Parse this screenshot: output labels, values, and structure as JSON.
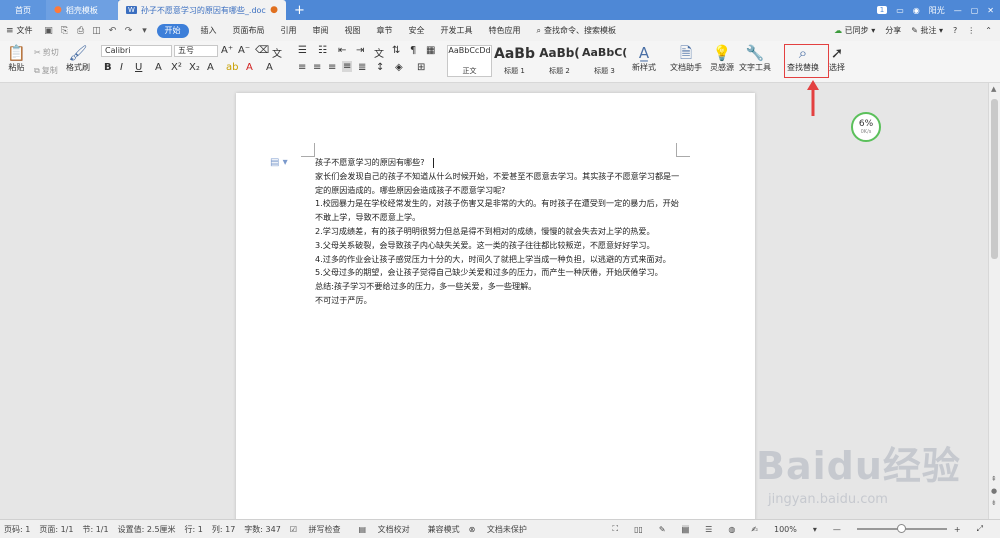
{
  "tabs": {
    "home": "首页",
    "template": "稻壳模板",
    "document": "孙子不愿意学习的原因有哪些_.doc",
    "page_badge": "1",
    "user": "阳光"
  },
  "menu": {
    "file": "文件",
    "items": [
      "开始",
      "插入",
      "页面布局",
      "引用",
      "审阅",
      "视图",
      "章节",
      "安全",
      "开发工具",
      "特色应用"
    ],
    "search": "查找命令、搜索模板",
    "sync": "已同步",
    "share": "分享",
    "comment": "批注"
  },
  "ribbon": {
    "paste": "粘贴",
    "cut": "剪切",
    "copy": "复制",
    "format_painter": "格式刷",
    "font_name": "Calibri",
    "font_size": "五号",
    "styles": [
      {
        "sample": "AaBbCcDd",
        "name": "正文"
      },
      {
        "sample": "AaBb",
        "name": "标题 1"
      },
      {
        "sample": "AaBb(",
        "name": "标题 2"
      },
      {
        "sample": "AaBbC(",
        "name": "标题 3"
      }
    ],
    "new_style": "新样式",
    "doc_helper": "文档助手",
    "inspiration": "灵感源",
    "text_tools": "文字工具",
    "find_replace": "查找替换",
    "select": "选择"
  },
  "document": {
    "lines": [
      "孩子不愿意学习的原因有哪些?",
      "家长们会发现自己的孩子不知道从什么时候开始，不爱甚至不愿意去学习。其实孩子不愿意学习都是一定的原因造成的。哪些原因会造成孩子不愿意学习呢?",
      "1.校园暴力是在学校经常发生的，对孩子伤害又是非常的大的。有时孩子在遭受到一定的暴力后，开始不敢上学，导致不愿意上学。",
      "2.学习成绩差，有的孩子明明很努力但总是得不到相对的成绩，慢慢的就会失去对上学的热爱。",
      "3.父母关系破裂，会导致孩子内心缺失关爱。这一类的孩子往往都比较叛逆，不愿意好好学习。",
      "4.过多的作业会让孩子感觉压力十分的大，时间久了就把上学当成一种负担，以逃避的方式来面对。",
      "5.父母过多的期望，会让孩子觉得自己缺少关爱和过多的压力，而产生一种厌倦，开始厌倦学习。",
      "总结:孩子学习不要给过多的压力，多一些关爱，多一些理解。",
      "不可过于严厉。"
    ]
  },
  "progress": {
    "percent": "6%",
    "speed": "0K/s"
  },
  "status": {
    "page_num": "页码: 1",
    "pages": "页面: 1/1",
    "section": "节: 1/1",
    "setting": "设置值: 2.5厘米",
    "row": "行: 1",
    "col": "列: 17",
    "words": "字数: 347",
    "spell": "拼写检查",
    "proof": "文档校对",
    "compat": "兼容模式",
    "protect": "文档未保护",
    "zoom": "100%",
    "zoom_fraction": 0.5
  },
  "watermark": {
    "main": "Baidu经验",
    "sub": "jingyan.baidu.com"
  },
  "colors": {
    "accent": "#3d7fd9",
    "tabbar": "#4e88d6",
    "highlight_box": "#e34040"
  }
}
